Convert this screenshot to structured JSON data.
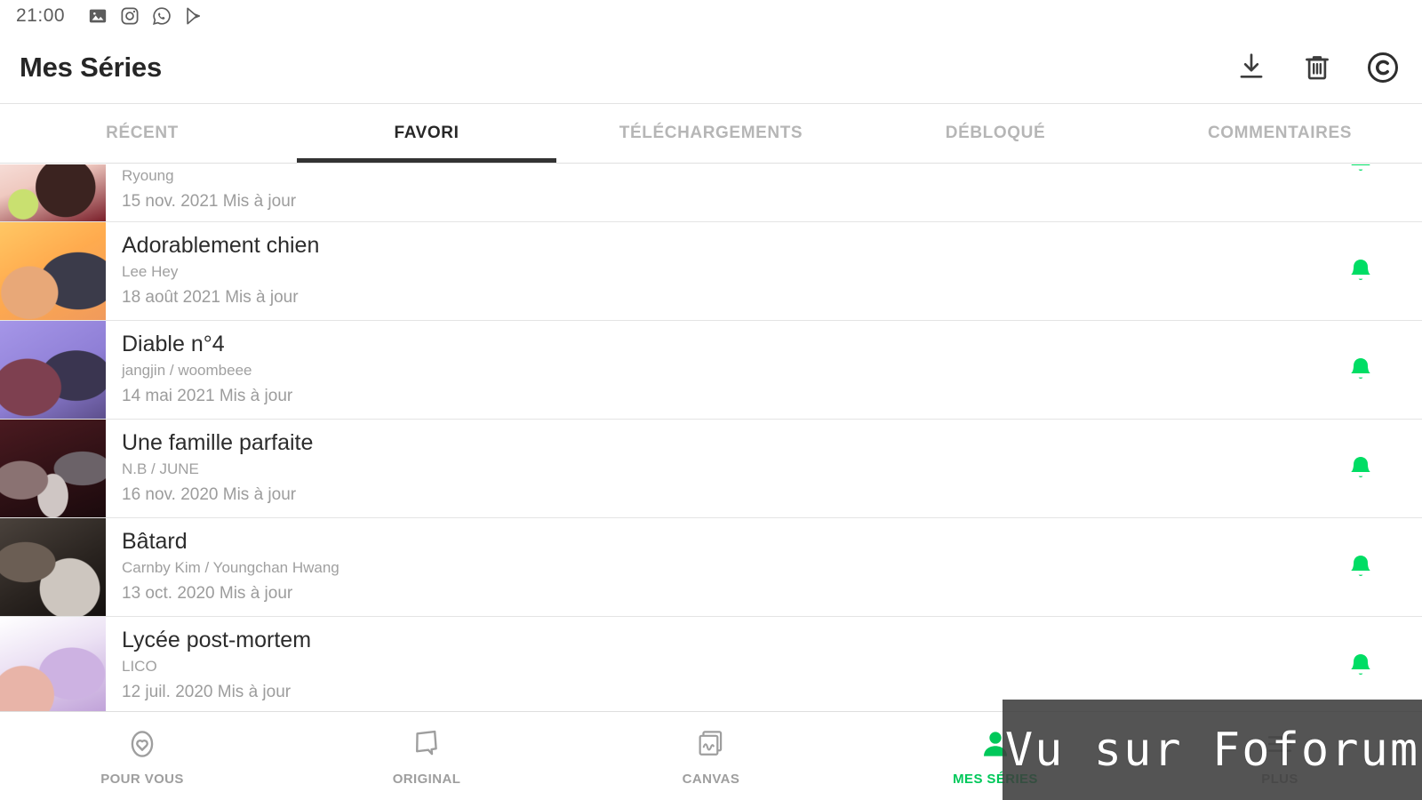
{
  "status_bar": {
    "time": "21:00",
    "icons": [
      "gallery-icon",
      "instagram-icon",
      "whatsapp-icon",
      "play-store-icon"
    ]
  },
  "app_bar": {
    "title": "Mes Séries",
    "actions": [
      {
        "name": "download-icon",
        "label": "Télécharger"
      },
      {
        "name": "trash-icon",
        "label": "Supprimer"
      },
      {
        "name": "copyright-icon",
        "label": "Copyright"
      }
    ]
  },
  "tabs": [
    {
      "label": "RÉCENT",
      "active": false
    },
    {
      "label": "FAVORI",
      "active": true
    },
    {
      "label": "TÉLÉCHARGEMENTS",
      "active": false
    },
    {
      "label": "DÉBLOQUÉ",
      "active": false
    },
    {
      "label": "COMMENTAIRES",
      "active": false
    }
  ],
  "series": [
    {
      "title": "",
      "author": "Ryoung",
      "date": "15 nov. 2021 Mis à jour",
      "notify": true,
      "clipped": true,
      "thumb_colors": [
        "#8b5b4a",
        "#f2d9d2",
        "#c9e070",
        "#7a1f2a"
      ]
    },
    {
      "title": "Adorablement chien",
      "author": "Lee Hey",
      "date": "18 août 2021 Mis à jour",
      "notify": true,
      "clipped": false,
      "thumb_colors": [
        "#ffb347",
        "#ffd98a",
        "#e0a06a",
        "#3b3b4a"
      ]
    },
    {
      "title": "Diable n°4",
      "author": "jangjin / woombeee",
      "date": "14 mai 2021 Mis à jour",
      "notify": true,
      "clipped": false,
      "thumb_colors": [
        "#9b8ee0",
        "#7e4050",
        "#c08a6a",
        "#3a3550"
      ]
    },
    {
      "title": "Une famille parfaite",
      "author": "N.B / JUNE",
      "date": "16 nov. 2020 Mis à jour",
      "notify": true,
      "clipped": false,
      "thumb_colors": [
        "#3a1318",
        "#6e5a5a",
        "#d8cfce",
        "#241014"
      ]
    },
    {
      "title": "Bâtard",
      "author": "Carnby Kim / Youngchan Hwang",
      "date": "13 oct. 2020 Mis à jour",
      "notify": true,
      "clipped": false,
      "thumb_colors": [
        "#2a2420",
        "#6b5e54",
        "#d2cbc4",
        "#15110f"
      ]
    },
    {
      "title": "Lycée post-mortem",
      "author": "LICO",
      "date": "12 juil. 2020 Mis à jour",
      "notify": true,
      "clipped": false,
      "thumb_colors": [
        "#f3eaf6",
        "#c8a8dc",
        "#e8b4a8",
        "#9e7fc4"
      ]
    }
  ],
  "bottom_nav": [
    {
      "label": "POUR VOUS",
      "icon": "heart-oval-icon",
      "active": false
    },
    {
      "label": "ORIGINAL",
      "icon": "torn-paper-icon",
      "active": false
    },
    {
      "label": "CANVAS",
      "icon": "canvas-pages-icon",
      "active": false
    },
    {
      "label": "MES SÉRIES",
      "icon": "person-icon",
      "active": true
    },
    {
      "label": "PLUS",
      "icon": "more-icon",
      "active": false
    }
  ],
  "watermark": {
    "text": "Vu sur Foforum"
  },
  "colors": {
    "accent_green": "#00c85a",
    "bell_green": "#00dd64",
    "text_primary": "#2c2c2c",
    "text_muted": "#9e9e9e",
    "tab_inactive": "#b6b6b6",
    "divider": "#e4e4e4"
  }
}
